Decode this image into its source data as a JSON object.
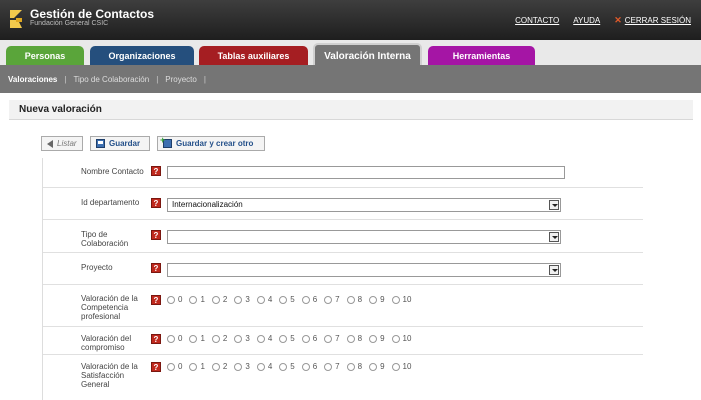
{
  "header": {
    "title": "Gestión de Contactos",
    "subtitle": "Fundación General CSIC",
    "links": {
      "contacto": "CONTACTO",
      "ayuda": "AYUDA",
      "cerrar": "CERRAR SESIÓN"
    }
  },
  "tabs": [
    {
      "label": "Personas",
      "color": "#5aa53a"
    },
    {
      "label": "Organizaciones",
      "color": "#254f7d"
    },
    {
      "label": "Tablas auxiliares",
      "color": "#a51e22"
    },
    {
      "label": "Valoración Interna",
      "color": "#757575",
      "active": true
    },
    {
      "label": "Herramientas",
      "color": "#a515a5"
    }
  ],
  "subnav": {
    "items": [
      "Valoraciones",
      "Tipo de Colaboración",
      "Proyecto"
    ],
    "separator": "|"
  },
  "page": {
    "title": "Nueva valoración"
  },
  "toolbar": {
    "listar": "Listar",
    "guardar": "Guardar",
    "guardar_otro": "Guardar y crear otro"
  },
  "form": {
    "help_symbol": "?",
    "fields": {
      "nombre": {
        "label": "Nombre Contacto",
        "value": ""
      },
      "departamento": {
        "label": "Id departamento",
        "value": "Internacionalización"
      },
      "tipo": {
        "label": "Tipo de Colaboración",
        "value": ""
      },
      "proyecto": {
        "label": "Proyecto",
        "value": ""
      },
      "competencia": {
        "label": "Valoración de la Competencia profesional"
      },
      "compromiso": {
        "label": "Valoración del compromiso"
      },
      "satisfaccion": {
        "label": "Valoración de la Satisfacción General"
      }
    },
    "scale": [
      "0",
      "1",
      "2",
      "3",
      "4",
      "5",
      "6",
      "7",
      "8",
      "9",
      "10"
    ]
  }
}
